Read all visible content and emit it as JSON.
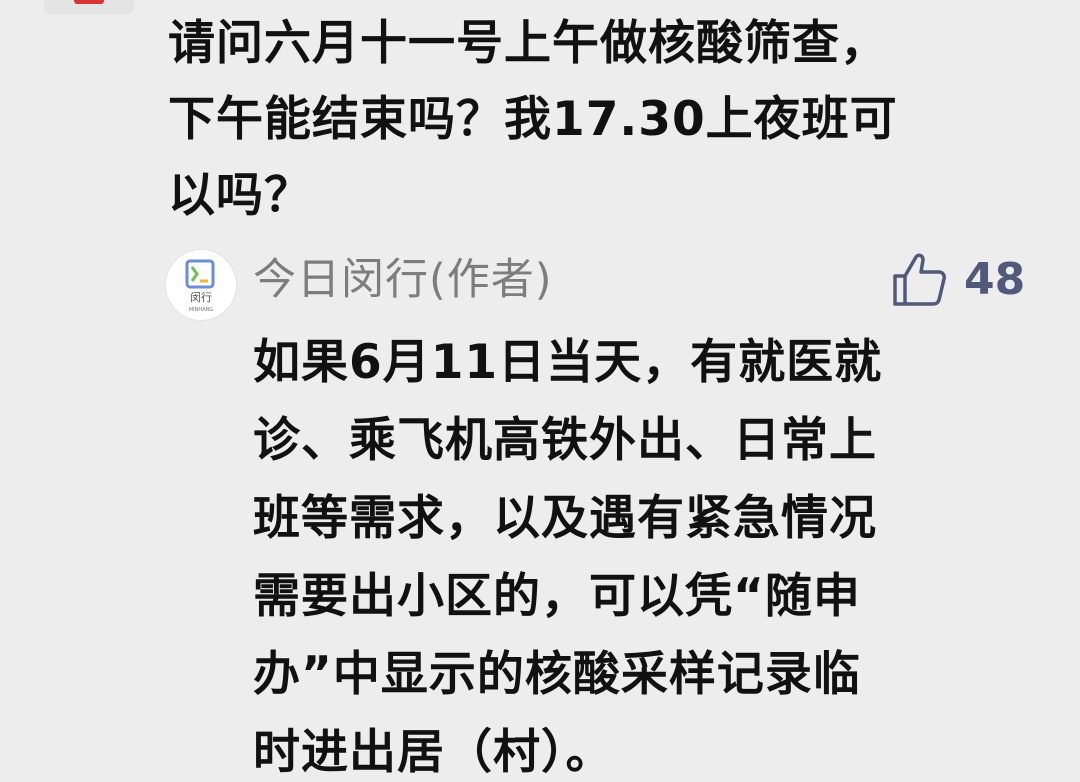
{
  "comment": {
    "text": "请问六月十一号上午做核酸筛查，\n下午能结束吗？我17.30上夜班可\n以吗？"
  },
  "reply": {
    "author": "今日闵行(作者)",
    "avatar_text": "闵行",
    "avatar_subtext": "MINHANG",
    "like_icon": "thumbs-up-icon",
    "like_count": "48",
    "text": "如果6月11日当天，有就医就\n诊、乘飞机高铁外出、日常上\n班等需求，以及遇有紧急情况\n需要出小区的，可以凭“随申\n办”中显示的核酸采样记录临\n时进出居（村）。"
  },
  "colors": {
    "background": "#ededed",
    "text": "#111111",
    "author": "#7d7d7d",
    "like": "#50597a",
    "avatar_accent": "#6b8cd9"
  }
}
